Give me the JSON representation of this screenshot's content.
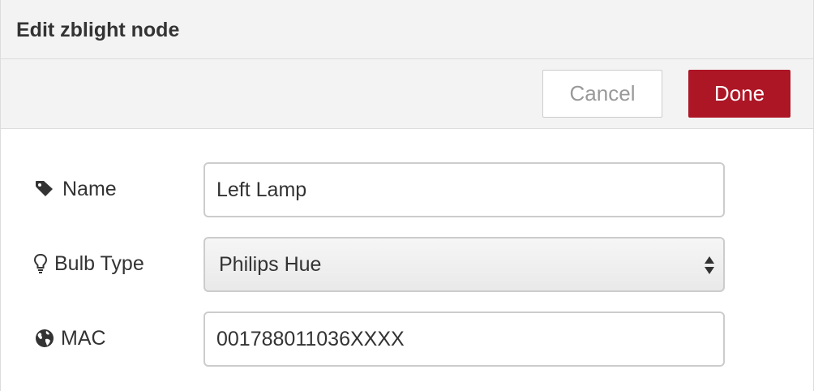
{
  "header": {
    "title": "Edit zblight node"
  },
  "toolbar": {
    "cancel_label": "Cancel",
    "done_label": "Done"
  },
  "form": {
    "name": {
      "label": "Name",
      "value": "Left Lamp",
      "icon": "tag-icon"
    },
    "bulb_type": {
      "label": "Bulb Type",
      "selected": "Philips Hue",
      "icon": "lightbulb-icon"
    },
    "mac": {
      "label": "MAC",
      "value": "001788011036XXXX",
      "icon": "globe-icon"
    }
  },
  "colors": {
    "primary": "#ad1625",
    "header_bg": "#f3f3f3",
    "border": "#cccccc",
    "text": "#333333",
    "muted_text": "#999999"
  }
}
